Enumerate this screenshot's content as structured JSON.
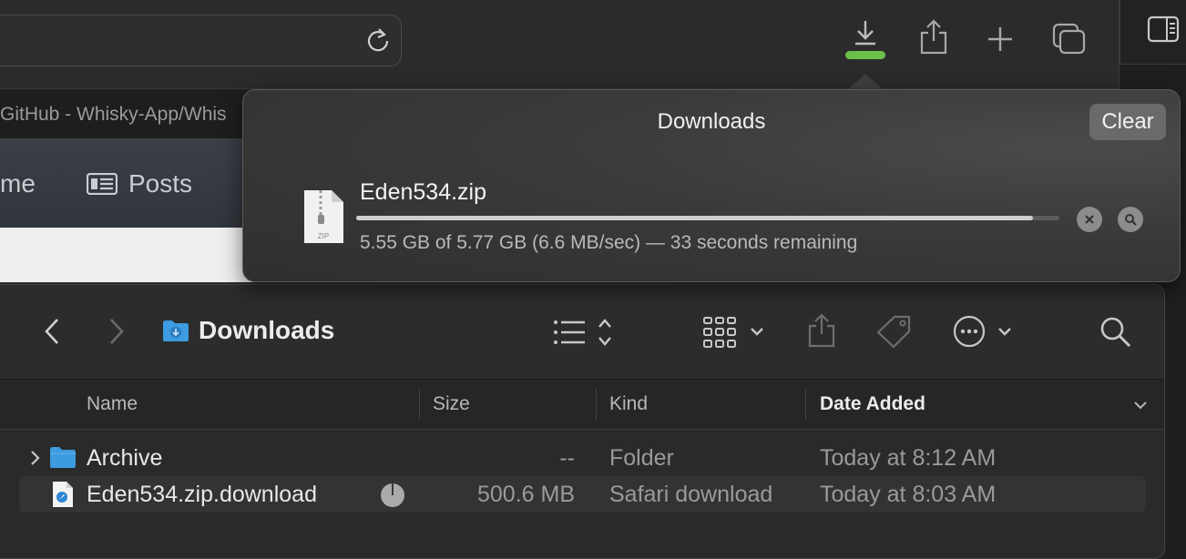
{
  "safari": {
    "tab_title": "GitHub - Whisky-App/Whis",
    "nav": {
      "home_label": "me",
      "posts_label": "Posts"
    },
    "toolbar_icons": [
      "reload-icon",
      "download-icon",
      "share-icon",
      "new-tab-icon",
      "tab-overview-icon",
      "sidebar-icon"
    ],
    "download_indicator_color": "#6cc04a"
  },
  "downloads_popover": {
    "title": "Downloads",
    "clear_label": "Clear",
    "item": {
      "file_name": "Eden534.zip",
      "icon_label": "ZIP",
      "status": "5.55 GB of 5.77 GB (6.6 MB/sec) — 33 seconds remaining",
      "progress": 0.962
    }
  },
  "finder": {
    "title": "Downloads",
    "columns": {
      "name": "Name",
      "size": "Size",
      "kind": "Kind",
      "date_added": "Date Added"
    },
    "rows": [
      {
        "name": "Archive",
        "size": "--",
        "kind": "Folder",
        "date_added": "Today at 8:12 AM"
      },
      {
        "name": "Eden534.zip.download",
        "size": "500.6 MB",
        "kind": "Safari download",
        "date_added": "Today at 8:03 AM"
      }
    ]
  }
}
